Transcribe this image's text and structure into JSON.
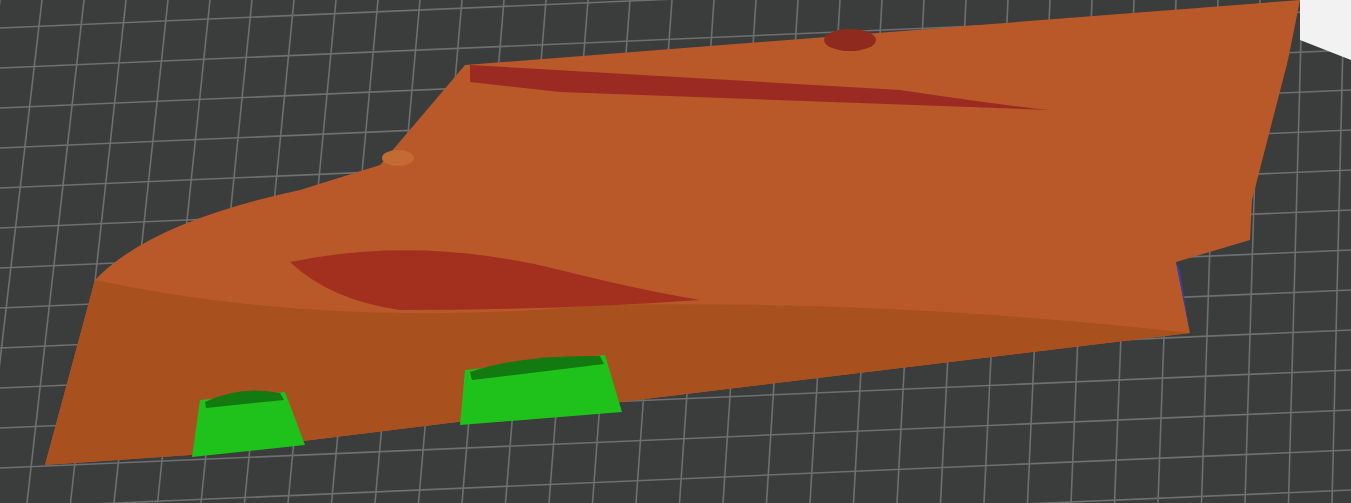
{
  "viewport": {
    "objects": [
      {
        "kind": "model",
        "color": "#b9592a"
      },
      {
        "kind": "support",
        "color": "#1ec21a"
      },
      {
        "kind": "support",
        "color": "#1ec21a"
      }
    ]
  }
}
